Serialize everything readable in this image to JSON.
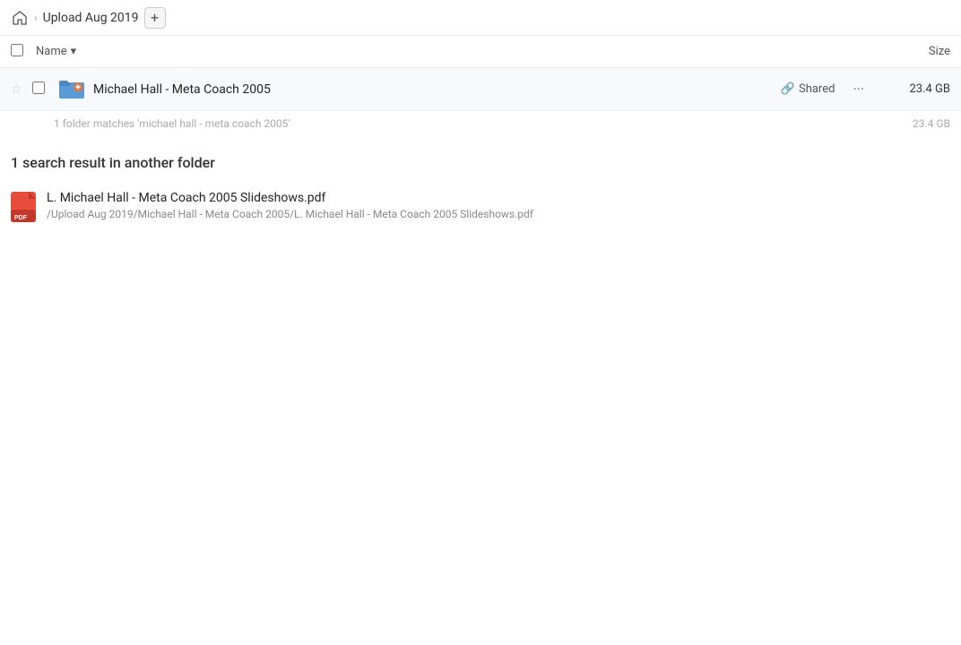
{
  "header": {
    "home_icon": "home",
    "breadcrumb_label": "Upload Aug 2019",
    "add_btn_label": "+"
  },
  "table_header": {
    "name_label": "Name",
    "size_label": "Size",
    "sort_icon": "▾"
  },
  "main_result": {
    "star_icon": "☆",
    "folder_name": "Michael Hall - Meta Coach 2005",
    "shared_label": "Shared",
    "more_label": "···",
    "size": "23.4 GB",
    "match_count_text": "1 folder matches 'michael hall - meta coach 2005'",
    "match_count_size": "23.4 GB"
  },
  "other_results": {
    "section_title": "1 search result in another folder",
    "items": [
      {
        "filename": "L. Michael Hall - Meta Coach 2005 Slideshows.pdf",
        "path": "/Upload Aug 2019/Michael Hall - Meta Coach 2005/L. Michael Hall - Meta Coach 2005 Slideshows.pdf"
      }
    ]
  }
}
